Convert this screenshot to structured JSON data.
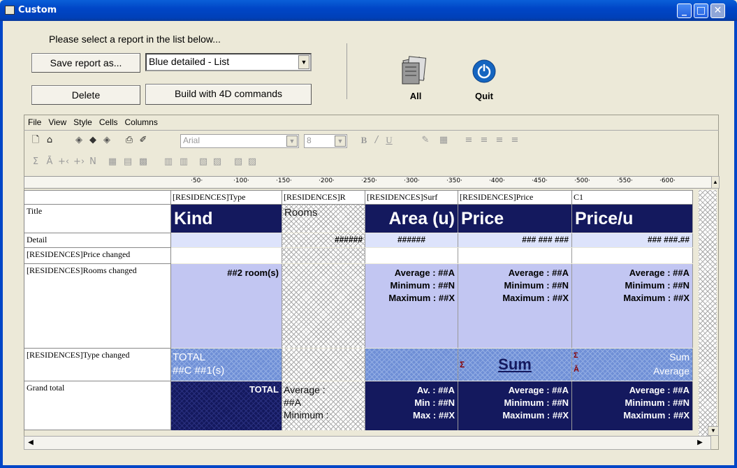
{
  "window": {
    "title": "Custom"
  },
  "top": {
    "instruction": "Please select a report in the list below...",
    "save_label": "Save report as...",
    "report_select_value": "Blue detailed - List",
    "delete_label": "Delete",
    "build_label": "Build with 4D commands",
    "all_label": "All",
    "quit_label": "Quit"
  },
  "menu": [
    "File",
    "View",
    "Style",
    "Cells",
    "Columns"
  ],
  "toolbar": {
    "font_value": "Arial",
    "size_value": "8"
  },
  "ruler": {
    "ticks": [
      "50",
      "100",
      "150",
      "200",
      "250",
      "300",
      "350",
      "400",
      "450",
      "500",
      "550",
      "600"
    ]
  },
  "columns": [
    "[RESIDENCES]Type",
    "[RESIDENCES]R",
    "[RESIDENCES]Surf",
    "[RESIDENCES]Price",
    "C1"
  ],
  "rows": {
    "title": "Title",
    "detail": "Detail",
    "price_changed": "[RESIDENCES]Price changed",
    "rooms_changed": "[RESIDENCES]Rooms changed",
    "type_changed": "[RESIDENCES]Type changed",
    "grand_total": "Grand total"
  },
  "cells": {
    "title": [
      "Kind",
      "Rooms",
      "Area (u)",
      "Price",
      "Price/u"
    ],
    "detail": [
      "",
      "######",
      "######",
      "### ### ###",
      "### ###.##"
    ],
    "rooms_kind": "##2 room(s)",
    "avg": "Average : ##A",
    "min": "Minimum : ##N",
    "max": "Maximum : ##X",
    "type_total": "TOTAL",
    "type_count": "##C ##1(s)",
    "sum_label": "Sum",
    "sum_small": "Sum",
    "average_small": "Average",
    "gt_total": "TOTAL",
    "gt_rooms_avg": "Average :",
    "gt_rooms_a": "##A",
    "gt_rooms_min": "Minimum :",
    "gt_av": "Av. : ##A",
    "gt_min": "Min : ##N",
    "gt_max": "Max : ##X"
  },
  "colors": {
    "navy": "#14195e",
    "titlebar": "#0046c7",
    "lavender": "#c2c6f2",
    "quit": "#1565c0"
  }
}
